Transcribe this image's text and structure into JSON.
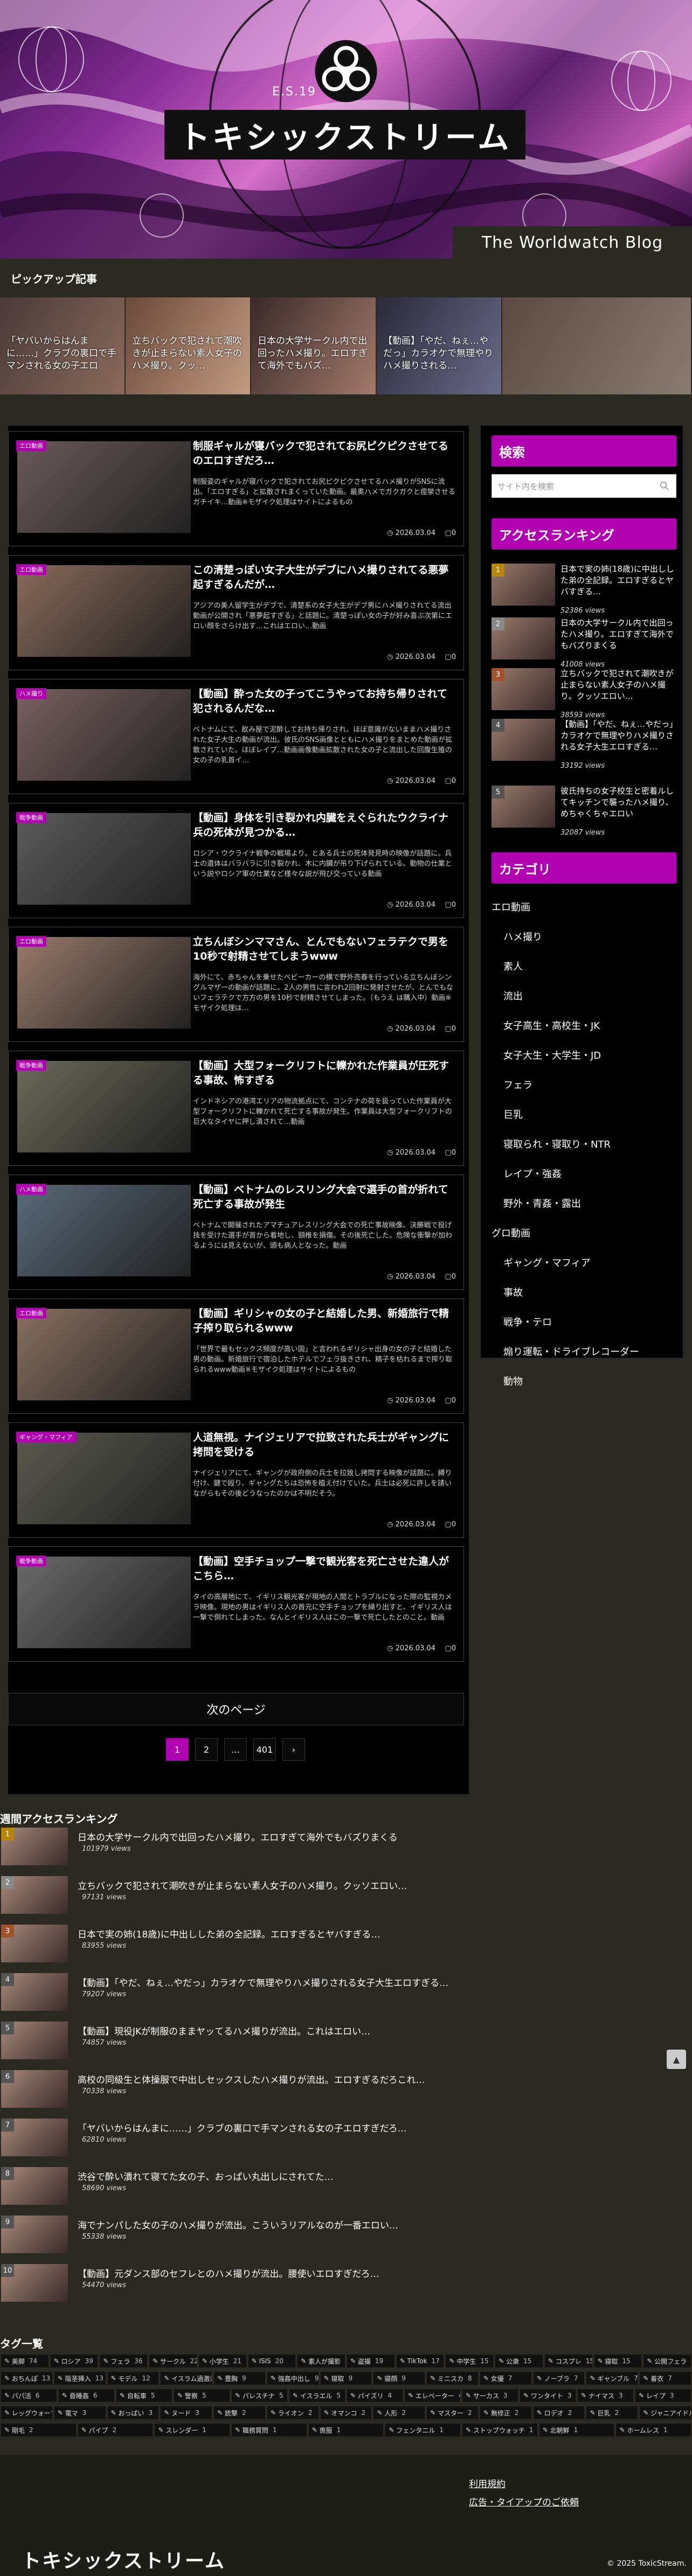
{
  "colors": {
    "accent": "#b000b0",
    "background": "#2a2a22",
    "panel": "#000000"
  },
  "header": {
    "logo_text": "トキシックストリーム",
    "es_label": "E.S.19",
    "subtitle": "The Worldwatch Blog"
  },
  "pickup": {
    "title": "ピックアップ記事",
    "items": [
      {
        "text": "「ヤバいからはんまに……」クラブの裏口で手マンされる女の子エロ"
      },
      {
        "text": "立ちバックで犯されて潮吹きが止まらない素人女子のハメ撮り。クッ…"
      },
      {
        "text": "日本の大学サークル内で出回ったハメ撮り。エロすぎて海外でもバズ…"
      },
      {
        "text": "【動画】「やだ、ねぇ…やだっ」カラオケで無理やりハメ撮りされる…"
      },
      {
        "text": ""
      }
    ]
  },
  "posts": [
    {
      "cat": "エロ動画",
      "title": "制服ギャルが寝バックで犯されてお尻ピクピクさせてるのエロすぎだろ…",
      "excerpt": "制服姿のギャルが寝バックで犯されてお尻ピクピクさせてるハメ撮りがSNSに流出。「エロすぎる」と拡散されまくっていた動画。最奥ハメでガクガクと痙攣させるガチイキ…動画※モザイク処理はサイトによるもの",
      "date": "2026.03.04",
      "comments": "0"
    },
    {
      "cat": "エロ動画",
      "title": "この清楚っぽい女子大生がデブにハメ撮りされてる悪夢起すぎるんだが…",
      "excerpt": "アジアの美人留学生がデブで、清楚系の女子大生がデブ男にハメ撮りされてる流出動画が公開され「悪夢起すぎる」と話題に。清楚っぽい女の子が好み喜ぶ次第にエロい顔をさらけ出す…これはエロい…動画",
      "date": "2026.03.04",
      "comments": "0"
    },
    {
      "cat": "ハメ撮り",
      "title": "【動画】酔った女の子ってこうやってお持ち帰りされて犯されるんだな…",
      "excerpt": "ベトナムにて、飲み屋で泥酔してお持ち帰りされ、ほぼ意識がないままハメ撮りされた女子大生の動画が流出。彼氏のSNS画像とともにハメ撮りをまとめた動画が拡散されていた。ほぼレイプ…動画画像動画拡散された女の子と流出した回腹生殖の女の子の乳首イ…",
      "date": "2026.03.04",
      "comments": "0"
    },
    {
      "cat": "戦争動画",
      "title": "【動画】身体を引き裂かれ内臓をえぐられたウクライナ兵の死体が見つかる…",
      "excerpt": "ロシア・ウクライナ戦争の戦場より。とある兵士の死体発見時の映像が話題に。兵士の遺体はバラバラに引き裂かれ、木に内臓が吊り下げられている。動物の仕業という説やロシア軍の仕業など様々な説が飛び交っている動画",
      "date": "2026.03.04",
      "comments": "0"
    },
    {
      "cat": "エロ動画",
      "title": "立ちんぼシンママさん、とんでもないフェラテクで男を10秒で射精させてしまうwww",
      "excerpt": "海外にて、赤ちゃんを乗せたベビーカーの横で野外売春を行っている立ちんぼシングルマザーの動画が話題に。2人の男性に言われ2回射に発射させたが、とんでもないフェラテクで方方の男を10秒で射精させてしまった。（もうえ は購入中）動画※モザイク処理は…",
      "date": "2026.03.04",
      "comments": "0"
    },
    {
      "cat": "戦争動画",
      "title": "【動画】大型フォークリフトに轢かれた作業員が圧死する事故、怖すぎる",
      "excerpt": "インドネシアの港湾エリアの物流拠点にて、コンテナの荷を扱っていた作業員が大型フォークリフトに轢かれて死亡する事故が発生。作業員は大型フォークリフトの巨大なタイヤに押し潰されて…動画",
      "date": "2026.03.04",
      "comments": "0"
    },
    {
      "cat": "ハメ動画",
      "title": "【動画】ベトナムのレスリング大会で選手の首が折れて死亡する事故が発生",
      "excerpt": "ベトナムで開催されたアマチュアレスリング大会での死亡事故映像。決勝戦で投げ技を受けた選手が首から着地し、頸椎を損傷。その後死亡した。危険な衝撃が加わるようには見えないが、頭も病人となった。動画",
      "date": "2026.03.04",
      "comments": "0"
    },
    {
      "cat": "エロ動画",
      "title": "【動画】ギリシャの女の子と結婚した男、新婚旅行で精子搾り取られるwww",
      "excerpt": "「世界で最もセックス頻度が高い国」と言われるギリシャ出身の女の子と結婚した男の動画。新婚旅行で宿泊したホテルでフェラ抜きされ、精子を枯れるまで搾り取られるwww動画※モザイク処理はサイトによるもの",
      "date": "2026.03.04",
      "comments": "0"
    },
    {
      "cat": "ギャング・マフィア",
      "title": "人道無視。ナイジェリアで拉致された兵士がギャングに拷問を受ける",
      "excerpt": "ナイジェリアにて、ギャングが政府側の兵士を拉致し拷問する映像が話題に。縛り付け、鍵で殴り、ギャングたちは恐怖を植え付けていた。兵士は必死に許しを請いながらもその後どうなったのかは不明だそう。",
      "date": "2026.03.04",
      "comments": "0"
    },
    {
      "cat": "戦争動画",
      "title": "【動画】空手チョップ一撃で観光客を死亡させた違人がこちら…",
      "excerpt": "タイの高層地にて、イギリス観光客が現地の人間とトラブルになった際の監視カメラ映像。現地の男はイギリス人の首元に空手チョップを繰り出すと、イギリス人は一撃で倒れてしまった。なんとイギリス人はこの一撃で死亡したとのこと。動画",
      "date": "2026.03.04",
      "comments": "0"
    }
  ],
  "pagination": {
    "next_label": "次のページ",
    "pages": [
      "1",
      "2",
      "…",
      "401",
      "›"
    ]
  },
  "sidebar": {
    "search": {
      "title": "検索",
      "placeholder": "サイト内を検索"
    },
    "ranking": {
      "title": "アクセスランキング",
      "items": [
        {
          "num": "1",
          "title": "日本で実の姉(18歳)に中出しした弟の全記録。エロすぎるとヤバすぎる…",
          "views": "52386 views"
        },
        {
          "num": "2",
          "title": "日本の大学サークル内で出回ったハメ撮り。エロすぎて海外でもバズりまくる",
          "views": "41008 views"
        },
        {
          "num": "3",
          "title": "立ちバックで犯されて潮吹きが止まらない素人女子のハメ撮り。クッソエロい…",
          "views": "38593 views"
        },
        {
          "num": "4",
          "title": "【動画】「やだ、ねぇ…やだっ」カラオケで無理やりハメ撮りされる女子大生エロすぎる…",
          "views": "33192 views"
        },
        {
          "num": "5",
          "title": "彼氏持ちの女子校生と密着ルしてキッチンで襲ったハメ撮り、めちゃくちゃエロい",
          "views": "32087 views"
        }
      ]
    },
    "category": {
      "title": "カテゴリ",
      "items": [
        {
          "label": "エロ動画",
          "level": 0
        },
        {
          "label": "ハメ撮り",
          "level": 1
        },
        {
          "label": "素人",
          "level": 1
        },
        {
          "label": "流出",
          "level": 1
        },
        {
          "label": "女子高生・高校生・JK",
          "level": 1
        },
        {
          "label": "女子大生・大学生・JD",
          "level": 1
        },
        {
          "label": "フェラ",
          "level": 1
        },
        {
          "label": "巨乳",
          "level": 1
        },
        {
          "label": "寝取られ・寝取り・NTR",
          "level": 1
        },
        {
          "label": "レイプ・強姦",
          "level": 1
        },
        {
          "label": "野外・青姦・露出",
          "level": 1
        },
        {
          "label": "グロ動画",
          "level": 0
        },
        {
          "label": "ギャング・マフィア",
          "level": 1
        },
        {
          "label": "事故",
          "level": 1
        },
        {
          "label": "戦争・テロ",
          "level": 1
        },
        {
          "label": "煽り運転・ドライブレコーダー",
          "level": 1
        },
        {
          "label": "動物",
          "level": 1
        }
      ]
    }
  },
  "weekly": {
    "title": "週間アクセスランキング",
    "items": [
      {
        "num": "1",
        "title": "日本の大学サークル内で出回ったハメ撮り。エロすぎて海外でもバズりまくる",
        "views": "101979 views"
      },
      {
        "num": "2",
        "title": "立ちバックで犯されて潮吹きが止まらない素人女子のハメ撮り。クッソエロい…",
        "views": "97131 views"
      },
      {
        "num": "3",
        "title": "日本で実の姉(18歳)に中出しした弟の全記録。エロすぎるとヤバすぎる…",
        "views": "83955 views"
      },
      {
        "num": "4",
        "title": "【動画】「やだ、ねぇ…やだっ」カラオケで無理やりハメ撮りされる女子大生エロすぎる…",
        "views": "79207 views"
      },
      {
        "num": "5",
        "title": "【動画】現役JKが制服のままヤッてるハメ撮りが流出。これはエロい…",
        "views": "74857 views"
      },
      {
        "num": "6",
        "title": "高校の同級生と体操服で中出しセックスしたハメ撮りが流出。エロすぎるだろこれ…",
        "views": "70338 views"
      },
      {
        "num": "7",
        "title": "「ヤバいからはんまに……」クラブの裏口で手マンされる女の子エロすぎだろ…",
        "views": "62810 views"
      },
      {
        "num": "8",
        "title": "渋谷で酔い潰れて寝てた女の子、おっぱい丸出しにされてた…",
        "views": "58690 views"
      },
      {
        "num": "9",
        "title": "海でナンパした女の子のハメ撮りが流出。こういうリアルなのが一番エロい…",
        "views": "55338 views"
      },
      {
        "num": "10",
        "title": "【動画】元ダンス部のセフレとのハメ撮りが流出。腰使いエロすぎだろ…",
        "views": "54470 views"
      }
    ]
  },
  "tags": {
    "title": "タグ一覧",
    "rows": [
      [
        {
          "t": "美脚",
          "c": "74"
        },
        {
          "t": "ロシア",
          "c": "39"
        },
        {
          "t": "フェラ",
          "c": "36"
        },
        {
          "t": "サークル",
          "c": "22"
        },
        {
          "t": "小学生",
          "c": "21"
        },
        {
          "t": "ISIS",
          "c": "20"
        },
        {
          "t": "素人が撮影",
          "c": "20"
        },
        {
          "t": "盗撮",
          "c": "19"
        },
        {
          "t": "TikTok",
          "c": "17"
        },
        {
          "t": "中学生",
          "c": "15"
        },
        {
          "t": "公衆",
          "c": "15"
        },
        {
          "t": "コスプレ",
          "c": "15"
        },
        {
          "t": "寝取",
          "c": "15"
        },
        {
          "t": "公開フェラ",
          "c": "13"
        }
      ],
      [
        {
          "t": "おちんぽ",
          "c": "13"
        },
        {
          "t": "陰茎挿入",
          "c": "13"
        },
        {
          "t": "モデル",
          "c": "12"
        },
        {
          "t": "イスラム過激派",
          "c": "12"
        },
        {
          "t": "豊胸",
          "c": "9"
        },
        {
          "t": "強姦中出し",
          "c": "9"
        },
        {
          "t": "寝取",
          "c": "9"
        },
        {
          "t": "寝顔",
          "c": "9"
        },
        {
          "t": "ミニスカ",
          "c": "8"
        },
        {
          "t": "女優",
          "c": "7"
        },
        {
          "t": "ノーブラ",
          "c": "7"
        },
        {
          "t": "ギャンブル",
          "c": "7"
        },
        {
          "t": "着衣",
          "c": "7"
        }
      ],
      [
        {
          "t": "パパ活",
          "c": "6"
        },
        {
          "t": "昏睡姦",
          "c": "6"
        },
        {
          "t": "自転車",
          "c": "5"
        },
        {
          "t": "警察",
          "c": "5"
        },
        {
          "t": "パレスチナ",
          "c": "5"
        },
        {
          "t": "イスラエル",
          "c": "5"
        },
        {
          "t": "パイズリ",
          "c": "4"
        },
        {
          "t": "エレベーター",
          "c": "4"
        },
        {
          "t": "サーカス",
          "c": "3"
        },
        {
          "t": "ワンタイト",
          "c": "3"
        },
        {
          "t": "ナイマス",
          "c": "3"
        },
        {
          "t": "レイプ",
          "c": "3"
        }
      ],
      [
        {
          "t": "レッグウォーマー",
          "c": "3"
        },
        {
          "t": "電マ",
          "c": "3"
        },
        {
          "t": "おっぱい",
          "c": "3"
        },
        {
          "t": "ヌード",
          "c": "3"
        },
        {
          "t": "銃撃",
          "c": "2"
        },
        {
          "t": "ライオン",
          "c": "2"
        },
        {
          "t": "オマンコ",
          "c": "2"
        },
        {
          "t": "人形",
          "c": "2"
        },
        {
          "t": "マスター",
          "c": "2"
        },
        {
          "t": "無修正",
          "c": "2"
        },
        {
          "t": "ロデオ",
          "c": "2"
        },
        {
          "t": "巨乳",
          "c": "2"
        },
        {
          "t": "ジャニアイドル",
          "c": "2"
        }
      ],
      [
        {
          "t": "剛毛",
          "c": "2"
        },
        {
          "t": "パイプ",
          "c": "2"
        },
        {
          "t": "スレンダー",
          "c": "1"
        },
        {
          "t": "職務質問",
          "c": "1"
        },
        {
          "t": "喪服",
          "c": "1"
        },
        {
          "t": "フェンタニル",
          "c": "1"
        },
        {
          "t": "ストップウォッチ",
          "c": "1"
        },
        {
          "t": "北朝鮮",
          "c": "1"
        },
        {
          "t": "ホームレス",
          "c": "1"
        }
      ]
    ]
  },
  "footer": {
    "links": [
      "利用規約",
      "広告・タイアップのご依頼"
    ],
    "logo": "トキシックストリーム",
    "copyright": "© 2025 ToxicStream."
  }
}
